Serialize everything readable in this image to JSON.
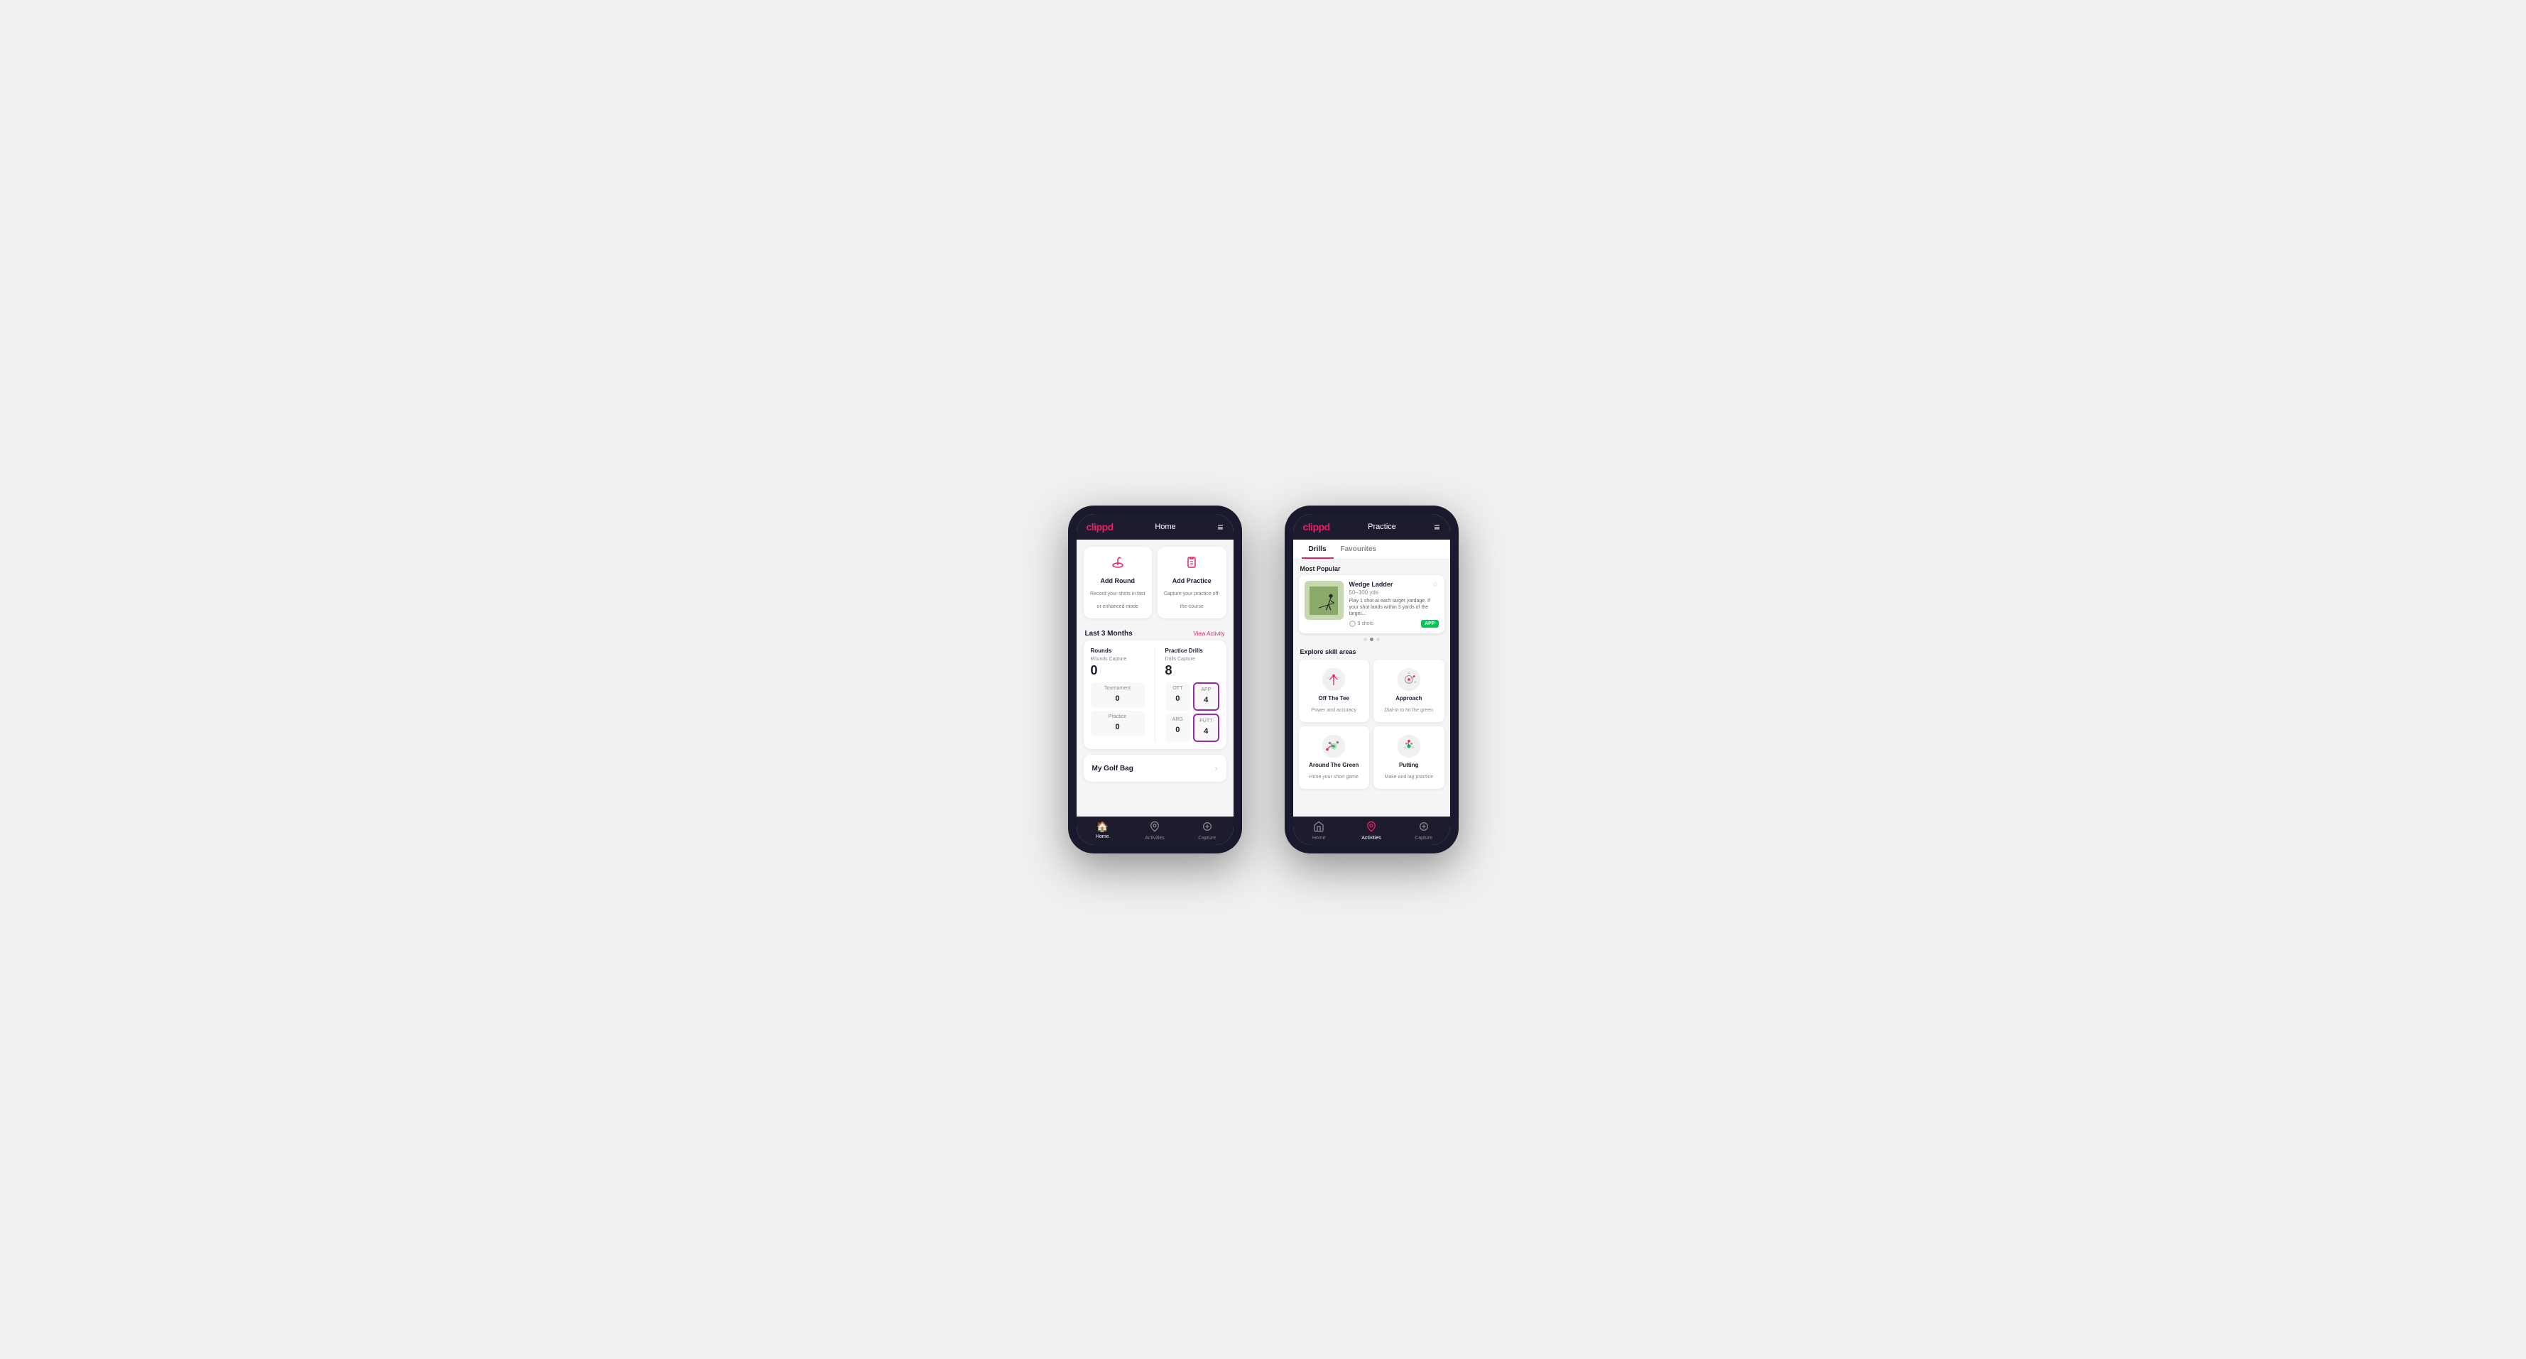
{
  "phone1": {
    "header": {
      "logo": "clippd",
      "title": "Home",
      "menuIcon": "≡"
    },
    "actionCards": [
      {
        "id": "add-round",
        "icon": "⛳",
        "title": "Add Round",
        "description": "Record your shots in fast or enhanced mode"
      },
      {
        "id": "add-practice",
        "icon": "📋",
        "title": "Add Practice",
        "description": "Capture your practice off-the-course"
      }
    ],
    "activitySection": {
      "title": "Last 3 Months",
      "link": "View Activity"
    },
    "rounds": {
      "title": "Rounds",
      "captureLabel": "Rounds Capture",
      "total": "0",
      "rows": [
        {
          "label": "Tournament",
          "value": "0"
        },
        {
          "label": "Practice",
          "value": "0"
        }
      ]
    },
    "practicedrills": {
      "title": "Practice Drills",
      "captureLabel": "Drills Capture",
      "total": "8",
      "cells": [
        {
          "label": "OTT",
          "value": "0"
        },
        {
          "label": "APP",
          "value": "4",
          "highlighted": true
        },
        {
          "label": "ARG",
          "value": "0"
        },
        {
          "label": "PUTT",
          "value": "4",
          "highlighted": true
        }
      ]
    },
    "myGolfBag": {
      "title": "My Golf Bag"
    },
    "bottomNav": [
      {
        "icon": "🏠",
        "label": "Home",
        "active": true
      },
      {
        "icon": "♻",
        "label": "Activities",
        "active": false
      },
      {
        "icon": "➕",
        "label": "Capture",
        "active": false
      }
    ]
  },
  "phone2": {
    "header": {
      "logo": "clippd",
      "title": "Practice",
      "menuIcon": "≡"
    },
    "tabs": [
      {
        "label": "Drills",
        "active": true
      },
      {
        "label": "Favourites",
        "active": false
      }
    ],
    "mostPopular": {
      "label": "Most Popular",
      "card": {
        "title": "Wedge Ladder",
        "subtitle": "50–100 yds",
        "description": "Play 1 shot at each target yardage. If your shot lands within 3 yards of the target...",
        "shots": "9 shots",
        "badge": "APP"
      }
    },
    "dots": [
      {
        "active": false
      },
      {
        "active": true
      },
      {
        "active": false
      }
    ],
    "exploreSkillAreas": {
      "label": "Explore skill areas",
      "skills": [
        {
          "name": "Off The Tee",
          "description": "Power and accuracy",
          "iconType": "tee"
        },
        {
          "name": "Approach",
          "description": "Dial-in to hit the green",
          "iconType": "approach"
        },
        {
          "name": "Around The Green",
          "description": "Hone your short game",
          "iconType": "around-green"
        },
        {
          "name": "Putting",
          "description": "Make and lag practice",
          "iconType": "putting"
        }
      ]
    },
    "bottomNav": [
      {
        "icon": "🏠",
        "label": "Home",
        "active": false
      },
      {
        "icon": "♻",
        "label": "Activities",
        "active": true
      },
      {
        "icon": "➕",
        "label": "Capture",
        "active": false
      }
    ]
  }
}
